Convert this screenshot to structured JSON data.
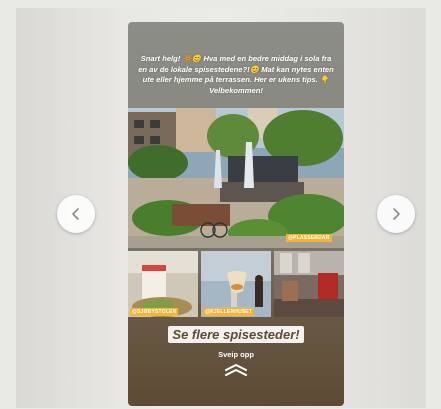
{
  "story": {
    "caption": "Snart helg! 🔆😊 Hva med en bedre middag i sola fra en av de lokale spisestedene?!😊 Mat kan nytes enten ute eller hjemme på terrassen. Her er ukens tips. 👇 Velbekommen!",
    "hero_tag": "@PLASSERDAR",
    "tiles": [
      {
        "tag": "@SJØBYSTOLEN"
      },
      {
        "tag": "@KJELLERHUSET"
      },
      {
        "tag": ""
      }
    ],
    "cta_label": "Se flere spisesteder!",
    "swipe_label": "Sveip opp"
  },
  "navigation": {
    "prev_icon": "chevron-left-icon",
    "next_icon": "chevron-right-icon"
  },
  "colors": {
    "cta_text": "#5d4a35",
    "tag_bg": "#f4b43a"
  }
}
